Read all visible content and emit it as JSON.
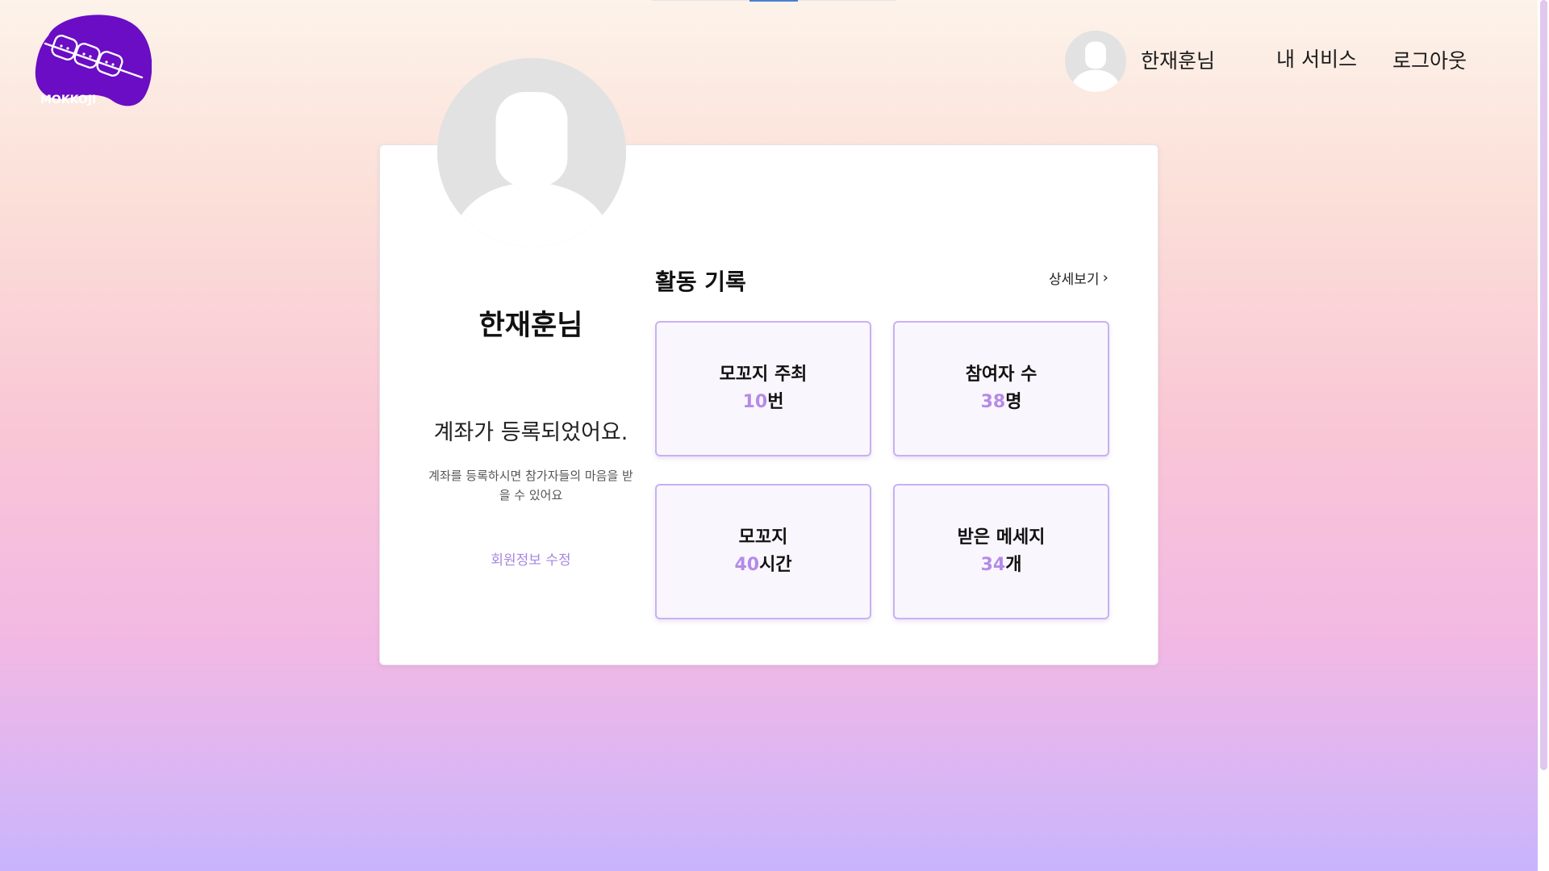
{
  "brand": {
    "name": "MOKKOJI",
    "color": "#6a0dc4"
  },
  "header": {
    "user_name": "한재훈님",
    "my_service": "내 서비스",
    "logout": "로그아웃"
  },
  "profile": {
    "name": "한재훈님",
    "account_status": "계좌가 등록되었어요.",
    "account_desc": "계좌를 등록하시면 참가자들의 마음을 받을 수 있어요",
    "edit_label": "회원정보 수정"
  },
  "activity": {
    "title": "활동 기록",
    "detail_label": "상세보기",
    "stats": [
      {
        "label": "모꼬지 주최",
        "value": "10",
        "unit": "번"
      },
      {
        "label": "참여자 수",
        "value": "38",
        "unit": "명"
      },
      {
        "label": "모꼬지",
        "value": "40",
        "unit": "시간"
      },
      {
        "label": "받은 메세지",
        "value": "34",
        "unit": "개"
      }
    ]
  },
  "colors": {
    "accent": "#b48be8",
    "box_border": "#c9b1f2",
    "box_bg": "#faf6fd"
  }
}
